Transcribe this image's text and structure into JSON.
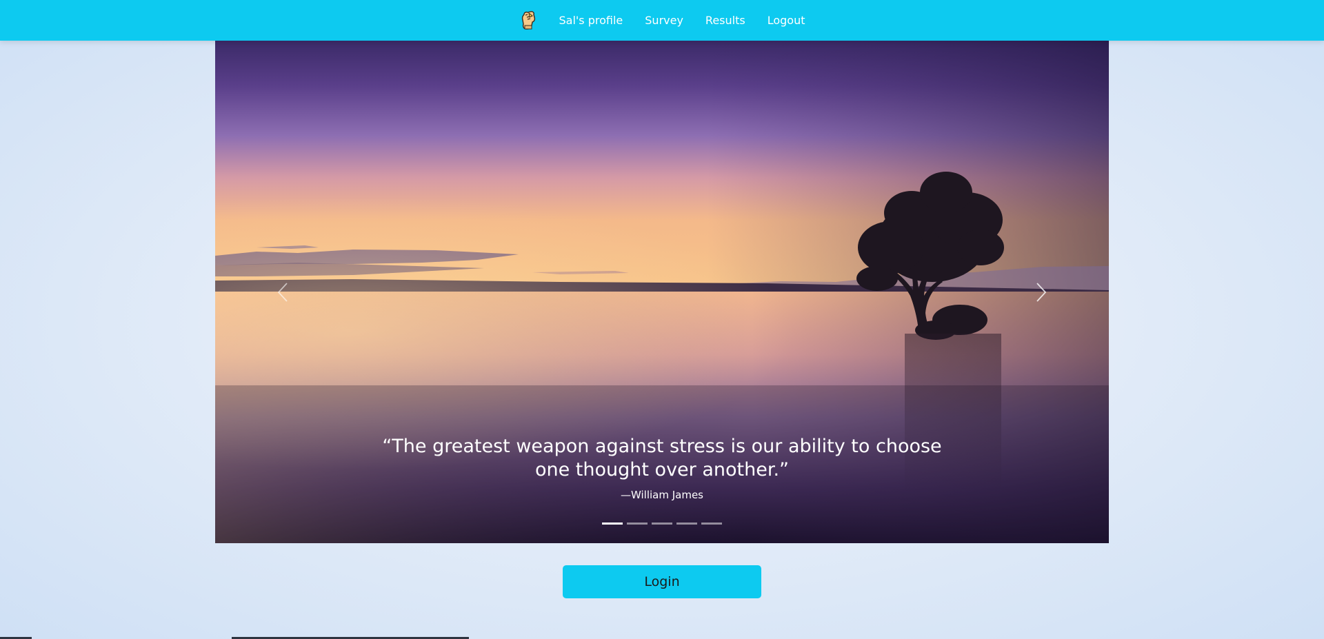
{
  "navbar": {
    "logo_icon": "hand-fist-icon",
    "links": [
      {
        "label": "Sal's profile"
      },
      {
        "label": "Survey"
      },
      {
        "label": "Results"
      },
      {
        "label": "Logout"
      }
    ],
    "background_color": "#0dcaf0"
  },
  "carousel": {
    "slide_image": "lake-sunset-tree",
    "caption": {
      "quote": "“The greatest weapon against stress is our ability to choose one thought over another.”",
      "author": "—William James"
    },
    "controls": {
      "prev_icon": "chevron-left-icon",
      "next_icon": "chevron-right-icon"
    },
    "indicators": {
      "count": 5,
      "active_index": 0
    }
  },
  "login": {
    "label": "Login",
    "color": "#0dcaf0"
  }
}
